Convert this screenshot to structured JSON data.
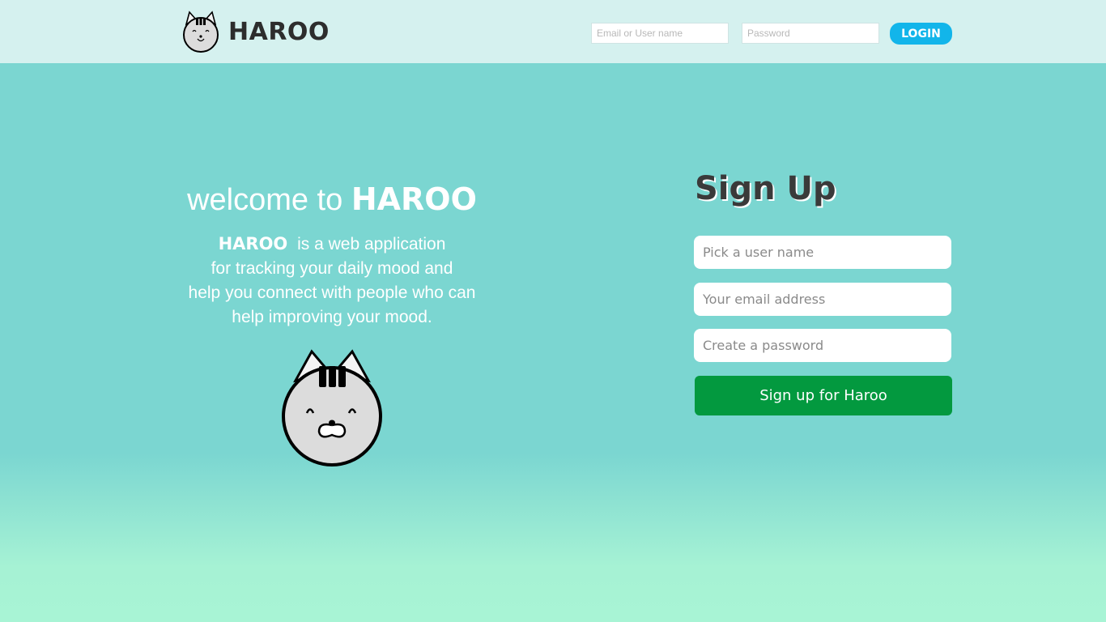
{
  "header": {
    "brand": "HAROO",
    "logo_icon": "cat-face-icon",
    "login_email_placeholder": "Email or User name",
    "login_password_placeholder": "Password",
    "login_button": "LOGIN"
  },
  "hero": {
    "welcome_prefix": "welcome to",
    "welcome_brand": "HAROO",
    "desc_brand": "HAROO",
    "desc_line1": "is a web application",
    "desc_line2": "for tracking your daily mood and",
    "desc_line3": "help you connect with people who can",
    "desc_line4": "help improving your mood.",
    "mascot_icon": "cat-mascot-icon"
  },
  "signup": {
    "title": "Sign Up",
    "username_placeholder": "Pick a user name",
    "email_placeholder": "Your email address",
    "password_placeholder": "Create a password",
    "submit_label": "Sign up for Haroo"
  },
  "colors": {
    "background": "#7bd6d1",
    "header_bg": "#d5f1ef",
    "login_button": "#12b5ea",
    "signup_button": "#03993f"
  }
}
